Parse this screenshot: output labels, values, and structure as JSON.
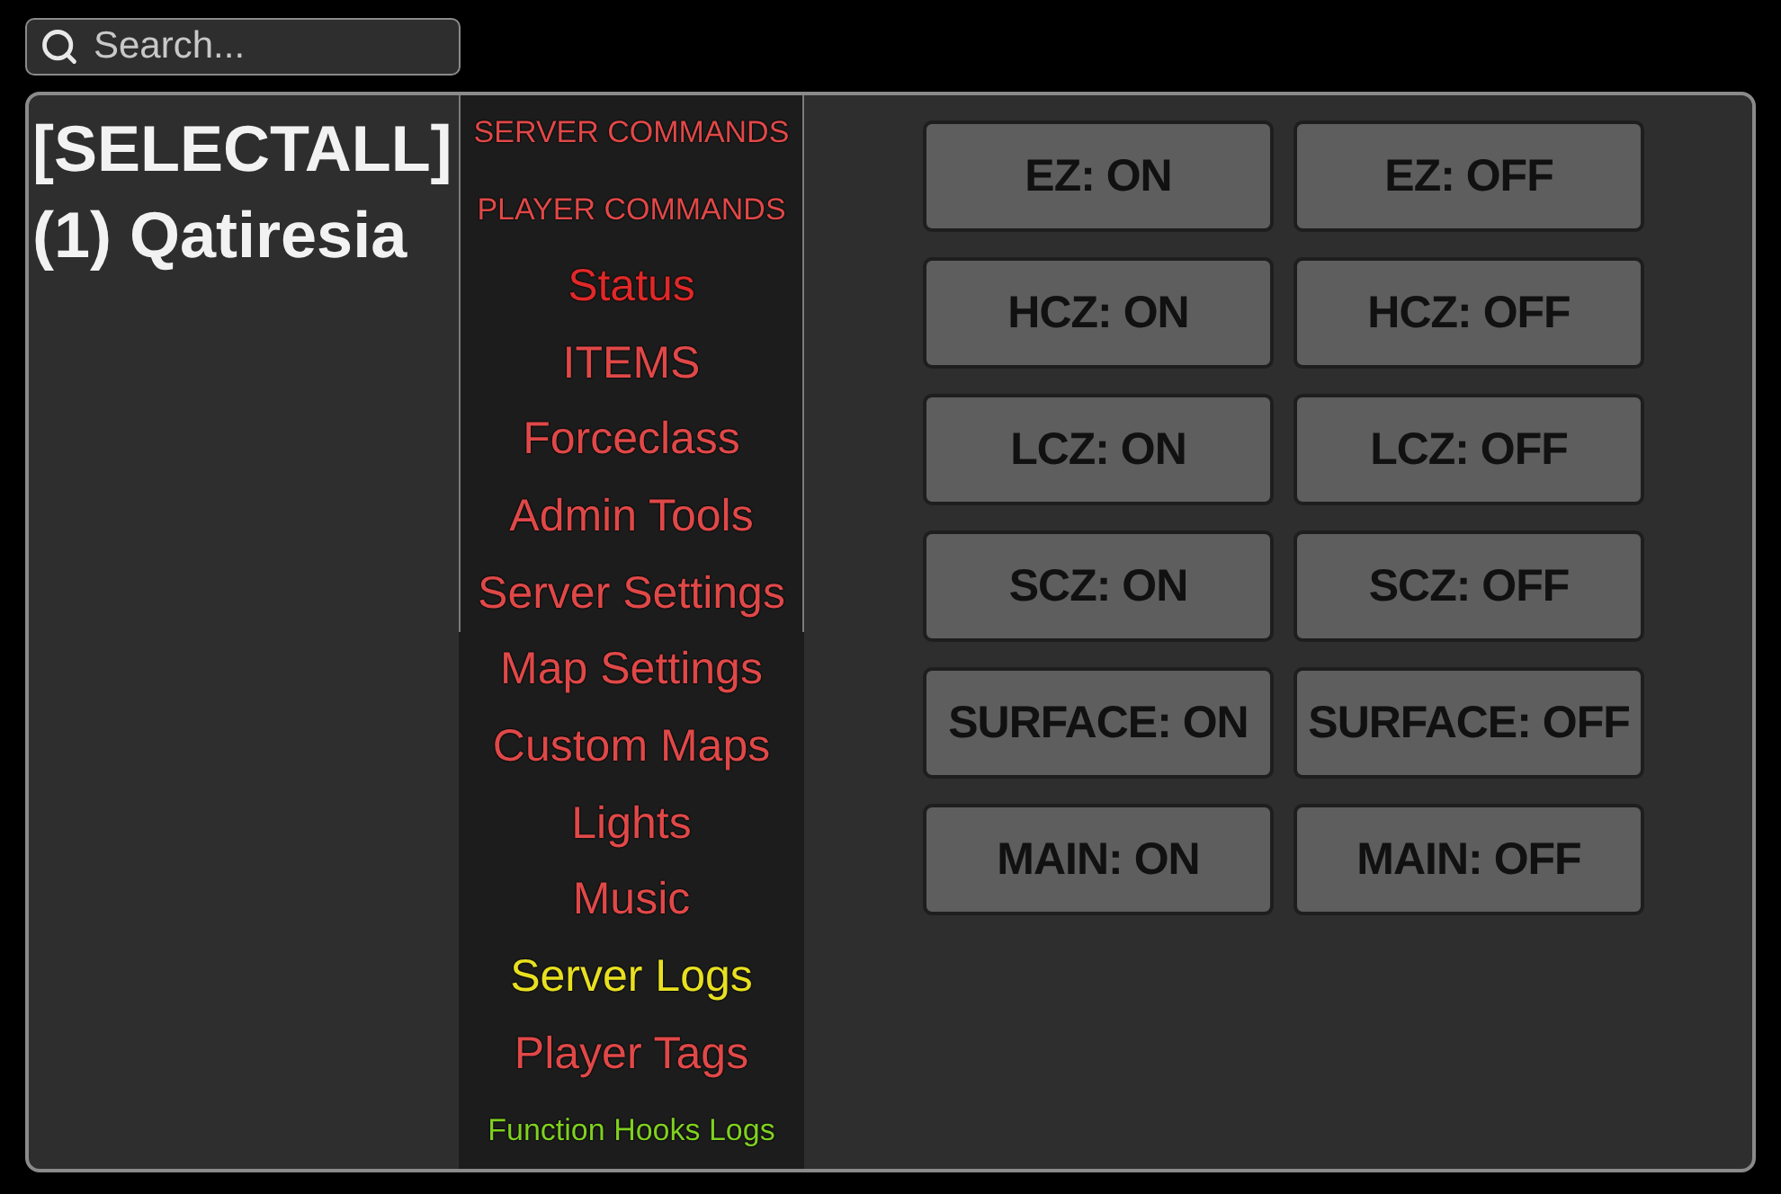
{
  "search": {
    "placeholder": "Search..."
  },
  "players": [
    {
      "label": "[SELECTALL]"
    },
    {
      "label": "(1) Qatiresia"
    }
  ],
  "menu": {
    "items": [
      {
        "label": "SERVER COMMANDS",
        "kind": "compact",
        "color": "#e04848"
      },
      {
        "label": "PLAYER COMMANDS",
        "kind": "compact",
        "color": "#e04848"
      },
      {
        "label": "Status",
        "kind": "regular",
        "color": "#e02828"
      },
      {
        "label": "ITEMS",
        "kind": "regular",
        "color": "#e04848"
      },
      {
        "label": "Forceclass",
        "kind": "regular",
        "color": "#e04848"
      },
      {
        "label": "Admin Tools",
        "kind": "regular",
        "color": "#e04848"
      },
      {
        "label": "Server Settings",
        "kind": "regular",
        "color": "#e04848"
      },
      {
        "label": "Map Settings",
        "kind": "regular",
        "color": "#e04848"
      },
      {
        "label": "Custom Maps",
        "kind": "regular",
        "color": "#e04848"
      },
      {
        "label": "Lights",
        "kind": "regular",
        "color": "#e04848"
      },
      {
        "label": "Music",
        "kind": "regular",
        "color": "#e04848"
      },
      {
        "label": "Server Logs",
        "kind": "regular",
        "color": "#e8e020"
      },
      {
        "label": "Player Tags",
        "kind": "regular",
        "color": "#e04848"
      },
      {
        "label": "Function Hooks Logs",
        "kind": "compact",
        "color": "#80d020"
      }
    ]
  },
  "zone_buttons": [
    {
      "label": "EZ: ON"
    },
    {
      "label": "EZ: OFF"
    },
    {
      "label": "HCZ: ON"
    },
    {
      "label": "HCZ: OFF"
    },
    {
      "label": "LCZ: ON"
    },
    {
      "label": "LCZ: OFF"
    },
    {
      "label": "SCZ: ON"
    },
    {
      "label": "SCZ: OFF"
    },
    {
      "label": "SURFACE: ON"
    },
    {
      "label": "SURFACE: OFF"
    },
    {
      "label": "MAIN: ON"
    },
    {
      "label": "MAIN: OFF"
    }
  ]
}
